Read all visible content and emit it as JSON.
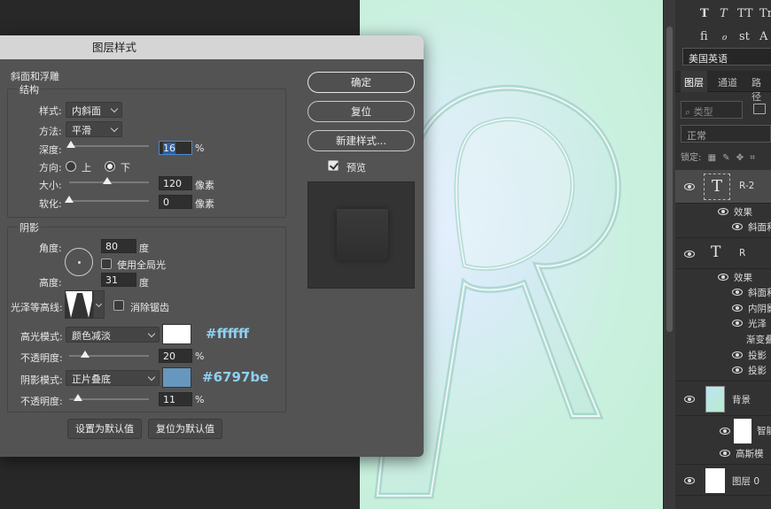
{
  "panel": {
    "type_row1": [
      "T",
      "T",
      "TT",
      "Tr"
    ],
    "type_row2": [
      "fi",
      "ℴ",
      "st",
      "A"
    ],
    "language": "美国英语",
    "tabs": [
      "图层",
      "通道",
      "路径"
    ],
    "search_placeholder": "类型",
    "blend_mode": "正常",
    "lock_label": "锁定:",
    "layers": [
      {
        "name": "R-2",
        "kind": "text"
      },
      {
        "name": "效果"
      },
      {
        "name": "斜面和"
      },
      {
        "name": "R",
        "kind": "text"
      },
      {
        "name": "效果"
      },
      {
        "name": "斜面和"
      },
      {
        "name": "内阴影"
      },
      {
        "name": "光泽"
      },
      {
        "name": "渐变叠"
      },
      {
        "name": "投影"
      },
      {
        "name": "投影"
      },
      {
        "name": "背景"
      },
      {
        "name": "智能"
      },
      {
        "name": "高斯模"
      },
      {
        "name": "图层 0"
      }
    ]
  },
  "dialog": {
    "title": "图层样式",
    "bevel_section": "斜面和浮雕",
    "structure_section": "结构",
    "style_label": "样式:",
    "style_value": "内斜面",
    "technique_label": "方法:",
    "technique_value": "平滑",
    "depth_label": "深度:",
    "depth_value": "16",
    "depth_unit": "%",
    "depth_level": 0.02,
    "direction_label": "方向:",
    "direction_up": "上",
    "direction_down": "下",
    "size_label": "大小:",
    "size_value": "120",
    "size_unit": "像素",
    "size_level": 0.48,
    "soften_label": "软化:",
    "soften_value": "0",
    "soften_unit": "像素",
    "soften_level": 0.0,
    "shading_section": "阴影",
    "angle_label": "角度:",
    "angle_value": "80",
    "angle_unit": "度",
    "global_light_label": "使用全局光",
    "altitude_label": "高度:",
    "altitude_value": "31",
    "altitude_unit": "度",
    "gloss_contour_label": "光泽等高线:",
    "antialias_label": "消除锯齿",
    "highlight_mode_label": "高光模式:",
    "highlight_mode_value": "颜色减淡",
    "highlight_color": "#ffffff",
    "highlight_hex_note": "#ffffff",
    "highlight_opacity_label": "不透明度:",
    "highlight_opacity_value": "20",
    "highlight_opacity_unit": "%",
    "highlight_opacity_level": 0.2,
    "shadow_mode_label": "阴影模式:",
    "shadow_mode_value": "正片叠底",
    "shadow_color": "#6797be",
    "shadow_hex_note": "#6797be",
    "shadow_opacity_label": "不透明度:",
    "shadow_opacity_value": "11",
    "shadow_opacity_unit": "%",
    "shadow_opacity_level": 0.11,
    "make_default": "设置为默认值",
    "reset_default": "复位为默认值",
    "ok": "确定",
    "reset": "复位",
    "new_style": "新建样式...",
    "preview_label": "预览",
    "note_color": "#8fd0f2"
  }
}
